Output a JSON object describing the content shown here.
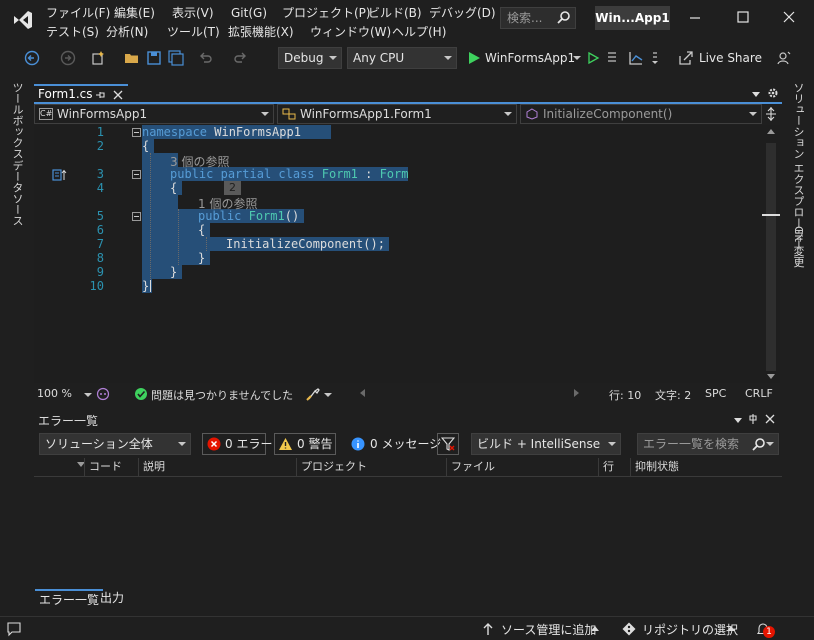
{
  "title_bar": {
    "menus_row1": [
      "ファイル(F)",
      "編集(E)",
      "表示(V)",
      "Git(G)",
      "プロジェクト(P)",
      "ビルド(B)",
      "デバッグ(D)"
    ],
    "menus_row2": [
      "テスト(S)",
      "分析(N)",
      "ツール(T)",
      "拡張機能(X)",
      "ウィンドウ(W)",
      "ヘルプ(H)"
    ],
    "search_label": "検索...",
    "solution_badge": "Win...App1"
  },
  "toolbar": {
    "configuration": "Debug",
    "platform": "Any CPU",
    "start_target": "WinFormsApp1",
    "live_share": "Live Share"
  },
  "side_left": {
    "toolbox": "ツールボックス",
    "data_sources": "データソース"
  },
  "side_right": {
    "solution_explorer": "ソリューション エクスプローラー",
    "git_changes": "Git 変更"
  },
  "document_tab": {
    "filename": "Form1.cs"
  },
  "navbar": {
    "project": "WinFormsApp1",
    "type": "WinFormsApp1.Form1",
    "member": "InitializeComponent()",
    "project_icon": "C#"
  },
  "editor": {
    "lines": [
      {
        "n": "1",
        "code": [
          {
            "t": "namespace",
            "c": "kw"
          },
          {
            "t": " WinFormsApp1",
            "c": "pl"
          }
        ]
      },
      {
        "n": "2",
        "code": [
          {
            "t": "{",
            "c": "pl"
          }
        ]
      },
      {
        "n": "3",
        "code": [
          {
            "t": "public",
            "c": "kw"
          },
          {
            "t": " ",
            "c": "pl"
          },
          {
            "t": "partial",
            "c": "kw"
          },
          {
            "t": " ",
            "c": "pl"
          },
          {
            "t": "class",
            "c": "kw"
          },
          {
            "t": " ",
            "c": "pl"
          },
          {
            "t": "Form1",
            "c": "ty"
          },
          {
            "t": " : ",
            "c": "pl"
          },
          {
            "t": "Form",
            "c": "ty"
          }
        ]
      },
      {
        "n": "4",
        "code": [
          {
            "t": "{",
            "c": "pl"
          }
        ]
      },
      {
        "n": "5",
        "code": [
          {
            "t": "public",
            "c": "kw"
          },
          {
            "t": " ",
            "c": "pl"
          },
          {
            "t": "Form1",
            "c": "ty"
          },
          {
            "t": "()",
            "c": "pl"
          }
        ]
      },
      {
        "n": "6",
        "code": [
          {
            "t": "{",
            "c": "pl"
          }
        ]
      },
      {
        "n": "7",
        "code": [
          {
            "t": "InitializeComponent();",
            "c": "pl"
          }
        ]
      },
      {
        "n": "8",
        "code": [
          {
            "t": "}",
            "c": "pl"
          }
        ]
      },
      {
        "n": "9",
        "code": [
          {
            "t": "}",
            "c": "pl"
          }
        ]
      },
      {
        "n": "10",
        "code": [
          {
            "t": "}",
            "c": "pl"
          }
        ]
      }
    ],
    "ref_hint_1": "3 個の参照",
    "ref_hint_2": "1 個の参照",
    "hint_badge": "2"
  },
  "editor_status": {
    "zoom": "100 %",
    "issues": "問題は見つかりませんでした",
    "line": "行: 10",
    "char": "文字: 2",
    "whitespace": "SPC",
    "line_ending": "CRLF"
  },
  "error_list": {
    "title": "エラー一覧",
    "scope": "ソリューション全体",
    "errors": "0 エラー",
    "warnings": "0 警告",
    "messages": "0 メッセージ",
    "source": "ビルド + IntelliSense",
    "search_placeholder": "エラー一覧を検索",
    "columns": [
      "コード",
      "説明",
      "プロジェクト",
      "ファイル",
      "行",
      "抑制状態"
    ]
  },
  "bottom_tabs": [
    "エラー一覧",
    "出力"
  ],
  "status_bar": {
    "source_control": "ソース管理に追加",
    "repository": "リポジトリの選択",
    "notifications": "1"
  },
  "colors": {
    "accent": "#4a8fd6",
    "selection": "#264f78",
    "keyword": "#569cd6",
    "type": "#4ec9b0",
    "line_number": "#2b91af",
    "error_icon": "#e51400",
    "warning_icon": "#f2c94c",
    "info_icon": "#3794ff",
    "run_green": "#3ed15e"
  }
}
